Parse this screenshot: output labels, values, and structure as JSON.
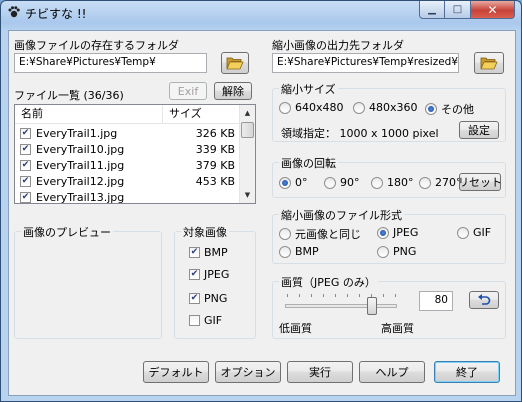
{
  "window": {
    "title": "チビすな !!"
  },
  "source": {
    "label": "画像ファイルの存在するフォルダ",
    "path": "E:¥Share¥Pictures¥Temp¥"
  },
  "output": {
    "label": "縮小画像の出力先フォルダ",
    "path": "E:¥Share¥Pictures¥Temp¥resized¥"
  },
  "file_list": {
    "label": "ファイル一覧 (36/36)",
    "exif_button": "Exif",
    "clear_button": "解除",
    "columns": [
      "名前",
      "サイズ"
    ],
    "rows": [
      {
        "name": "EveryTrail1.jpg",
        "size": "326 KB",
        "checked": true
      },
      {
        "name": "EveryTrail10.jpg",
        "size": "339 KB",
        "checked": true
      },
      {
        "name": "EveryTrail11.jpg",
        "size": "379 KB",
        "checked": true
      },
      {
        "name": "EveryTrail12.jpg",
        "size": "453 KB",
        "checked": true
      },
      {
        "name": "EveryTrail13.jpg",
        "size": "",
        "checked": true
      }
    ]
  },
  "preview": {
    "label": "画像のプレビュー"
  },
  "target_images": {
    "label": "対象画像",
    "items": [
      {
        "label": "BMP",
        "checked": true
      },
      {
        "label": "JPEG",
        "checked": true
      },
      {
        "label": "PNG",
        "checked": true
      },
      {
        "label": "GIF",
        "checked": false
      }
    ]
  },
  "resize": {
    "label": "縮小サイズ",
    "options": [
      "640x480",
      "480x360",
      "その他"
    ],
    "selected": "その他",
    "area_text": "領域指定： 1000 x 1000 pixel",
    "settings_button": "設定"
  },
  "rotation": {
    "label": "画像の回転",
    "options": [
      "0°",
      "90°",
      "180°",
      "270°"
    ],
    "selected": "0°",
    "reset_button": "リセット"
  },
  "format": {
    "label": "縮小画像のファイル形式",
    "options": [
      "元画像と同じ",
      "JPEG",
      "GIF",
      "BMP",
      "PNG"
    ],
    "selected": "JPEG"
  },
  "quality": {
    "label": "画質（JPEG のみ）",
    "value": "80",
    "level": 0.8,
    "low_label": "低画質",
    "high_label": "高画質"
  },
  "buttons": {
    "default": "デフォルト",
    "options": "オプション",
    "run": "実行",
    "help": "ヘルプ",
    "exit": "終了"
  },
  "colors": {
    "checkmark": "#2a3f7a",
    "radio": "#1d4aa3",
    "close": "#c7423a"
  }
}
